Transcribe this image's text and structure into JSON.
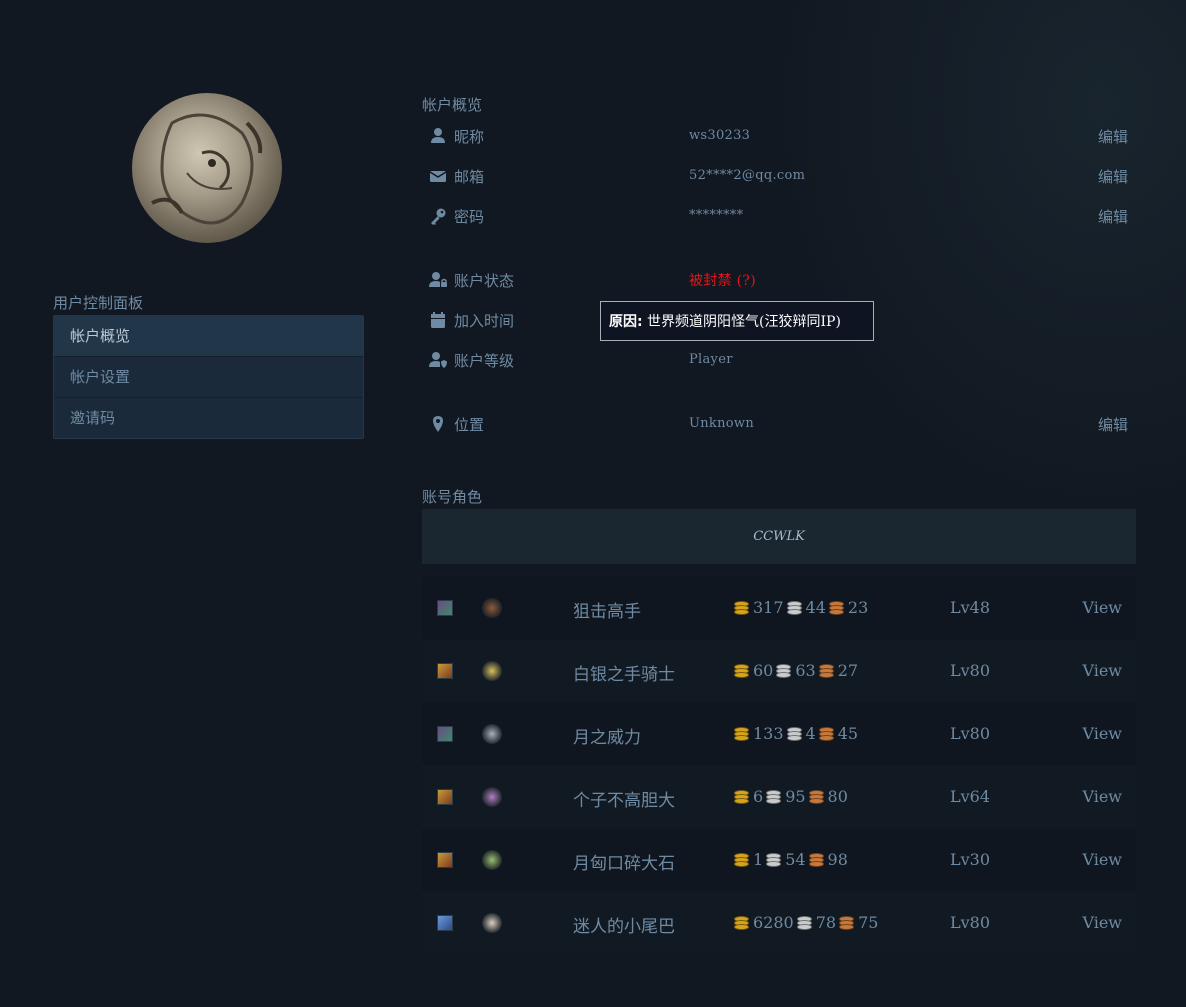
{
  "sidebar": {
    "title": "用户控制面板",
    "items": [
      {
        "label": "帐户概览",
        "active": true
      },
      {
        "label": "帐户设置",
        "active": false
      },
      {
        "label": "邀请码",
        "active": false
      }
    ]
  },
  "overview": {
    "title": "帐户概览",
    "nickname": {
      "icon": "user-icon",
      "label": "昵称",
      "value": "ws30233",
      "edit": "编辑"
    },
    "email": {
      "icon": "envelope-icon",
      "label": "邮箱",
      "value": "52****2@qq.com",
      "edit": "编辑"
    },
    "password": {
      "icon": "key-icon",
      "label": "密码",
      "value": "********",
      "edit": "编辑"
    },
    "status": {
      "icon": "user-lock-icon",
      "label": "账户状态",
      "value": "被封禁 (?)"
    },
    "join_time": {
      "icon": "calendar-icon",
      "label": "加入时间",
      "value": ""
    },
    "level": {
      "icon": "user-shield-icon",
      "label": "账户等级",
      "value": "Player"
    },
    "location": {
      "icon": "map-marker-icon",
      "label": "位置",
      "value": "Unknown",
      "edit": "编辑"
    }
  },
  "ban_tooltip": {
    "prefix": "原因:",
    "text": " 世界频道阴阳怪气(汪狡辩同IP)"
  },
  "characters": {
    "title": "账号角色",
    "realm": "CCWLK",
    "rows": [
      {
        "race_icon": "night-elf-female-icon",
        "class_icon": "hunter-icon",
        "name": "狙击高手",
        "gold": "317",
        "silver": "44",
        "copper": "23",
        "level": "Lv48",
        "view": "View"
      },
      {
        "race_icon": "human-female-icon",
        "class_icon": "paladin-icon",
        "name": "白银之手骑士",
        "gold": "60",
        "silver": "63",
        "copper": "27",
        "level": "Lv80",
        "view": "View"
      },
      {
        "race_icon": "night-elf-female-icon",
        "class_icon": "druid-icon",
        "name": "月之威力",
        "gold": "133",
        "silver": "4",
        "copper": "45",
        "level": "Lv80",
        "view": "View"
      },
      {
        "race_icon": "human-female-icon",
        "class_icon": "warlock-icon",
        "name": "个子不高胆大",
        "gold": "6",
        "silver": "95",
        "copper": "80",
        "level": "Lv64",
        "view": "View"
      },
      {
        "race_icon": "human-female-icon",
        "class_icon": "rogue-icon",
        "name": "月匈口碎大石",
        "gold": "1",
        "silver": "54",
        "copper": "98",
        "level": "Lv30",
        "view": "View"
      },
      {
        "race_icon": "draenei-female-icon",
        "class_icon": "priest-icon",
        "name": "迷人的小尾巴",
        "gold": "6280",
        "silver": "78",
        "copper": "75",
        "level": "Lv80",
        "view": "View"
      }
    ]
  },
  "colors": {
    "background": "#111821",
    "text": "#6f8aa3",
    "banned": "#e4151a",
    "gold": "#d6a31c",
    "silver": "#c9cbcc",
    "copper": "#c7783a"
  }
}
